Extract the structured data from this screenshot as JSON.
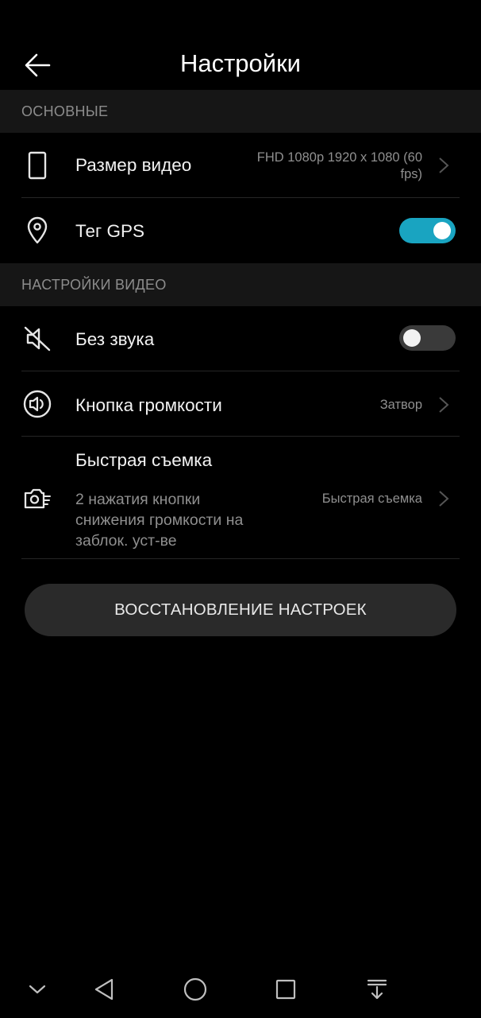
{
  "header": {
    "title": "Настройки"
  },
  "sections": {
    "basic": "ОСНОВНЫЕ",
    "video": "НАСТРОЙКИ ВИДЕО"
  },
  "rows": {
    "video_size": {
      "label": "Размер видео",
      "value_line1": "FHD 1080p 1920 x 1080 (60",
      "value_line2": "fps)",
      "icon": "phone-portrait-icon"
    },
    "gps_tag": {
      "label": "Тег GPS",
      "enabled": true,
      "icon": "location-pin-icon"
    },
    "mute": {
      "label": "Без звука",
      "enabled": false,
      "icon": "speaker-muted-icon"
    },
    "volume_button": {
      "label": "Кнопка громкости",
      "value": "Затвор",
      "icon": "speaker-icon"
    },
    "quick_shot": {
      "label": "Быстрая съемка",
      "sub_line1": "2 нажатия кнопки",
      "sub_line2": "снижения громкости на",
      "sub_line3": "заблок. уст-ве",
      "value": "Быстрая съемка",
      "icon": "quick-camera-icon"
    }
  },
  "reset_button": {
    "label": "ВОССТАНОВЛЕНИЕ НАСТРОЕК"
  },
  "navbar": {
    "icons": [
      "collapse-icon",
      "back-triangle-icon",
      "home-circle-icon",
      "recents-square-icon",
      "notification-pull-icon"
    ]
  },
  "colors": {
    "background": "#000000",
    "section_header": "#161616",
    "accent": "#19a4c1",
    "button": "#2a2a2a"
  }
}
